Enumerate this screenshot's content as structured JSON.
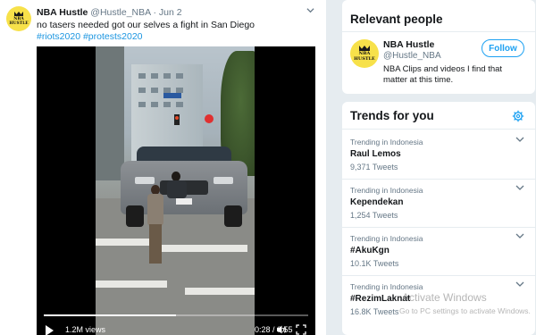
{
  "tweet": {
    "author_name": "NBA Hustle",
    "author_handle": "@Hustle_NBA",
    "separator": "·",
    "date": "Jun 2",
    "text": "no tasers needed got our selves a fight in San Diego",
    "hashtags": "#riots2020 #protests2020",
    "avatar_text_line1": "NBA",
    "avatar_text_line2": "HUSTLE",
    "video": {
      "views": "1.2M views",
      "time": "0:28 / 0:55",
      "progress": 0.5
    }
  },
  "relevant_people": {
    "title": "Relevant people",
    "name": "NBA Hustle",
    "handle": "@Hustle_NBA",
    "follow_label": "Follow",
    "bio": "NBA Clips and videos I find that matter at this time.",
    "avatar_text_line1": "NBA",
    "avatar_text_line2": "HUSTLE"
  },
  "trends": {
    "title": "Trends for you",
    "items": [
      {
        "context": "Trending in Indonesia",
        "name": "Raul Lemos",
        "count": "9,371 Tweets"
      },
      {
        "context": "Trending in Indonesia",
        "name": "Kependekan",
        "count": "1,254 Tweets"
      },
      {
        "context": "Trending in Indonesia",
        "name": "#AkuKgn",
        "count": "10.1K Tweets"
      },
      {
        "context": "Trending in Indonesia",
        "name": "#RezimLaknat",
        "count": "16.8K Tweets"
      }
    ]
  },
  "watermark": {
    "line1": "Activate Windows",
    "line2": "Go to PC settings to activate Windows."
  },
  "colors": {
    "accent": "#1da1f2",
    "link": "#1b95e0",
    "muted": "#657786",
    "background": "#e6ecf0",
    "avatar": "#f7e14a"
  },
  "icons": {
    "tweet_menu": "chevron-down-icon",
    "play": "play-icon",
    "volume": "volume-icon",
    "fullscreen": "fullscreen-icon",
    "settings": "gear-icon"
  }
}
